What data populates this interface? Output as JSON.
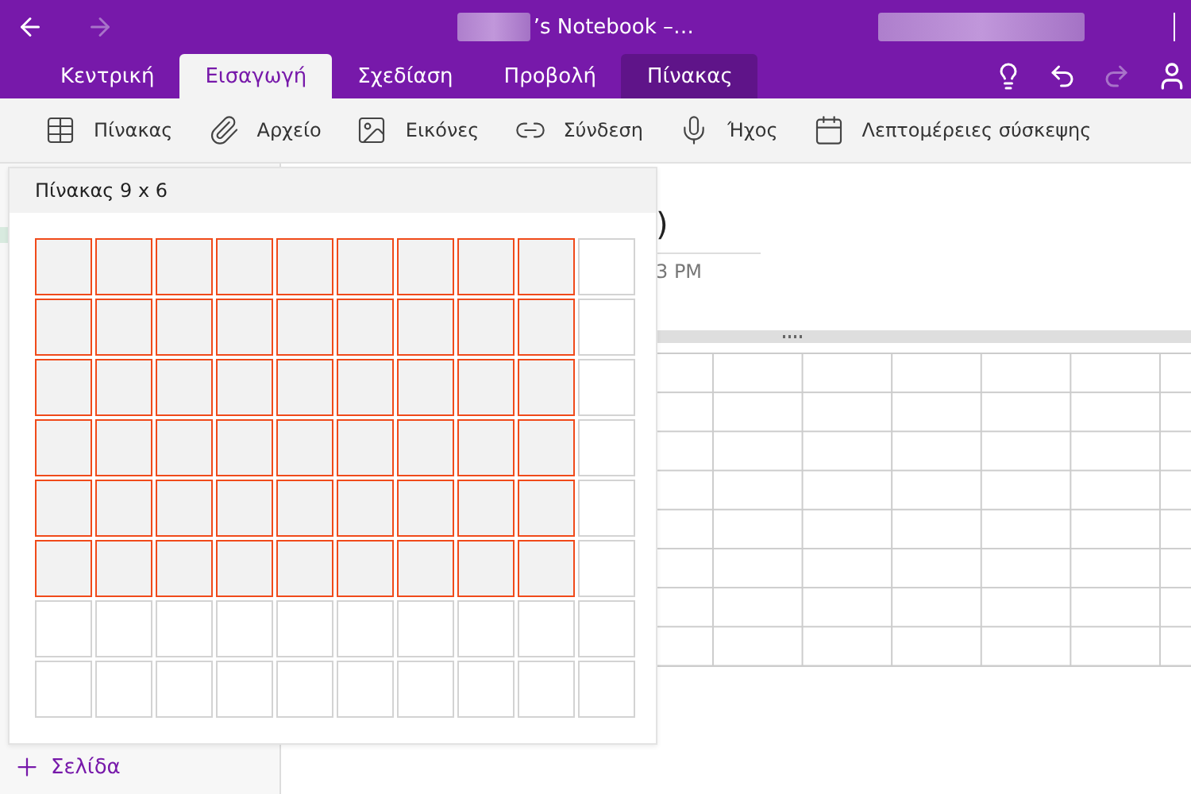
{
  "title_bar": {
    "title": "’s Notebook –…"
  },
  "tabs": [
    {
      "label": "Κεντρική",
      "selected": false,
      "kind": "normal"
    },
    {
      "label": "Εισαγωγή",
      "selected": true,
      "kind": "normal"
    },
    {
      "label": "Σχεδίαση",
      "selected": false,
      "kind": "normal"
    },
    {
      "label": "Προβολή",
      "selected": false,
      "kind": "normal"
    },
    {
      "label": "Πίνακας",
      "selected": false,
      "kind": "context"
    }
  ],
  "ribbon": [
    {
      "label": "Πίνακας"
    },
    {
      "label": "Αρχείο"
    },
    {
      "label": "Εικόνες"
    },
    {
      "label": "Σύνδεση"
    },
    {
      "label": "Ήχος"
    },
    {
      "label": "Λεπτομέρειες σύσκεψης"
    }
  ],
  "page": {
    "title": ")",
    "time": "3 PM"
  },
  "table_picker": {
    "heading": "Πίνακας 9 x 6",
    "rows": [
      {
        "cells": [
          true,
          true,
          true,
          true,
          true,
          true,
          true,
          true,
          true,
          false
        ]
      },
      {
        "cells": [
          true,
          true,
          true,
          true,
          true,
          true,
          true,
          true,
          true,
          false
        ]
      },
      {
        "cells": [
          true,
          true,
          true,
          true,
          true,
          true,
          true,
          true,
          true,
          false
        ]
      },
      {
        "cells": [
          true,
          true,
          true,
          true,
          true,
          true,
          true,
          true,
          true,
          false
        ]
      },
      {
        "cells": [
          true,
          true,
          true,
          true,
          true,
          true,
          true,
          true,
          true,
          false
        ]
      },
      {
        "cells": [
          true,
          true,
          true,
          true,
          true,
          true,
          true,
          true,
          true,
          false
        ]
      },
      {
        "cells": [
          false,
          false,
          false,
          false,
          false,
          false,
          false,
          false,
          false,
          false
        ]
      },
      {
        "cells": [
          false,
          false,
          false,
          false,
          false,
          false,
          false,
          false,
          false,
          false
        ]
      }
    ]
  },
  "add_page": {
    "label": "Σελίδα"
  }
}
